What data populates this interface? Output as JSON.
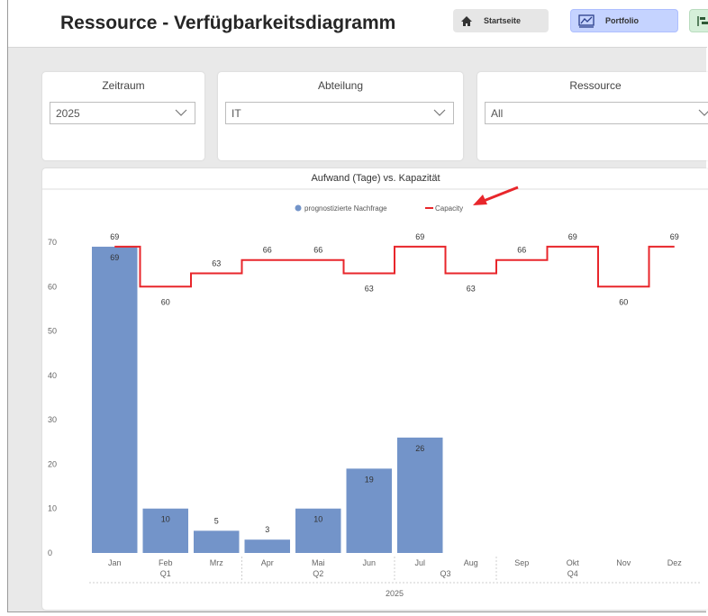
{
  "header": {
    "title": "Ressource - Verfügbarkeitsdiagramm",
    "buttons": [
      {
        "label": "Startseite",
        "icon": "home-icon"
      },
      {
        "label": "Portfolio",
        "icon": "portfolio-chart-icon"
      },
      {
        "label": "",
        "icon": "timeline-icon"
      }
    ]
  },
  "filters": {
    "zeitraum": {
      "label": "Zeitraum",
      "value": "2025"
    },
    "abteilung": {
      "label": "Abteilung",
      "value": "IT"
    },
    "ressource": {
      "label": "Ressource",
      "value": "All"
    }
  },
  "chart_data": {
    "type": "bar",
    "title": "Aufwand (Tage) vs. Kapazität",
    "categories": [
      "Jan",
      "Feb",
      "Mrz",
      "Apr",
      "Mai",
      "Jun",
      "Jul",
      "Aug",
      "Sep",
      "Okt",
      "Nov",
      "Dez"
    ],
    "quarters": [
      {
        "label": "Q1",
        "months": 3
      },
      {
        "label": "Q2",
        "months": 3
      },
      {
        "label": "Q3",
        "months": 2
      },
      {
        "label": "Q4",
        "months": 3
      }
    ],
    "year_label": "2025",
    "series": [
      {
        "name": "prognostizierte Nachfrage",
        "type": "bar",
        "color": "#7394c9",
        "values": [
          69,
          10,
          5,
          3,
          10,
          19,
          26,
          null,
          null,
          null,
          null,
          null
        ]
      },
      {
        "name": "Capacity",
        "type": "step-line",
        "color": "#e8262b",
        "values": [
          69,
          60,
          63,
          66,
          66,
          63,
          69,
          63,
          66,
          69,
          60,
          69
        ]
      }
    ],
    "ylim": [
      0,
      70
    ],
    "yticks": [
      0,
      10,
      20,
      30,
      40,
      50,
      60,
      70
    ],
    "legend_position": "top-center",
    "grid": false,
    "annotation": {
      "type": "arrow",
      "color": "#e8262b",
      "points_to": "legend"
    }
  }
}
